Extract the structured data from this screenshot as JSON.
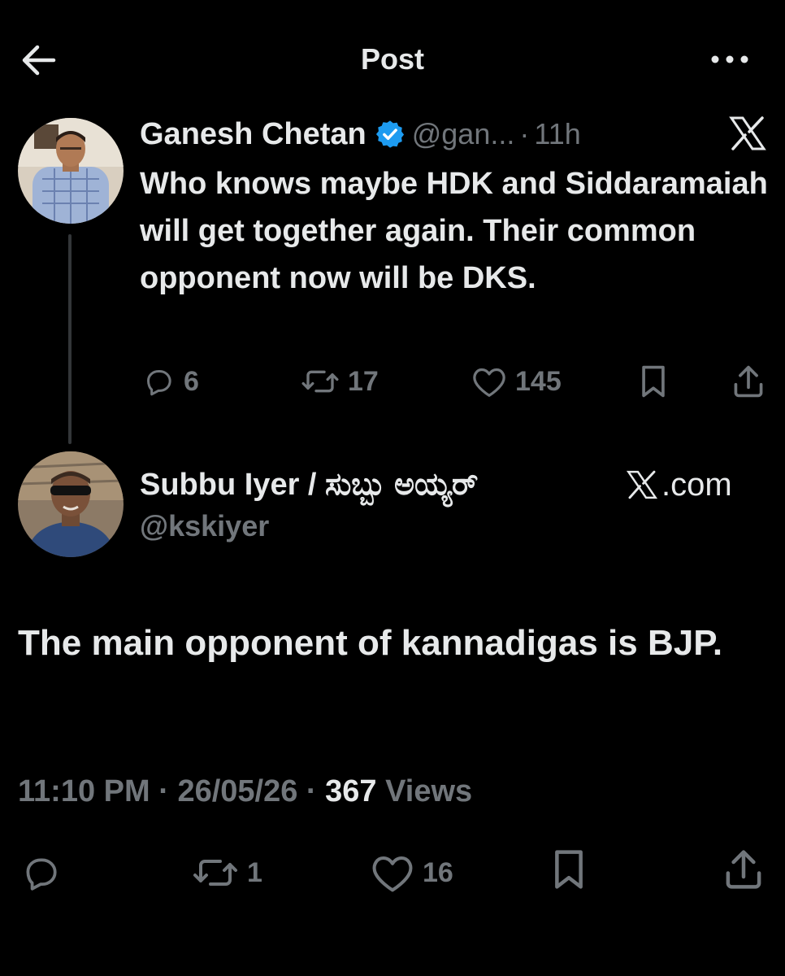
{
  "header": {
    "title": "Post"
  },
  "quoted": {
    "name": "Ganesh Chetan",
    "handle": "@gan...",
    "separator": "·",
    "time": "11h",
    "text": "Who knows maybe HDK and Siddaramaiah will get together again. Their common opponent now will be DKS.",
    "replies": "6",
    "reposts": "17",
    "likes": "145"
  },
  "reply": {
    "name": "Subbu Iyer / ಸುಬ್ಬು ಅಯ್ಯರ್",
    "source": ".com",
    "handle": "@kskiyer",
    "text": "The main opponent of kannadigas is BJP.",
    "time": "11:10 PM",
    "dot": "·",
    "date": "26/05/26",
    "views_count": "367",
    "views_label": "Views",
    "reposts": "1",
    "likes": "16"
  },
  "colors": {
    "background": "#000000",
    "text": "#e7e9ea",
    "muted": "#71767b",
    "verified": "#1d9bf0",
    "thread_line": "#333639"
  },
  "icons": [
    "back-arrow-icon",
    "more-icon",
    "verified-badge-icon",
    "x-logo-icon",
    "reply-icon",
    "repost-icon",
    "like-icon",
    "bookmark-icon",
    "share-icon"
  ]
}
